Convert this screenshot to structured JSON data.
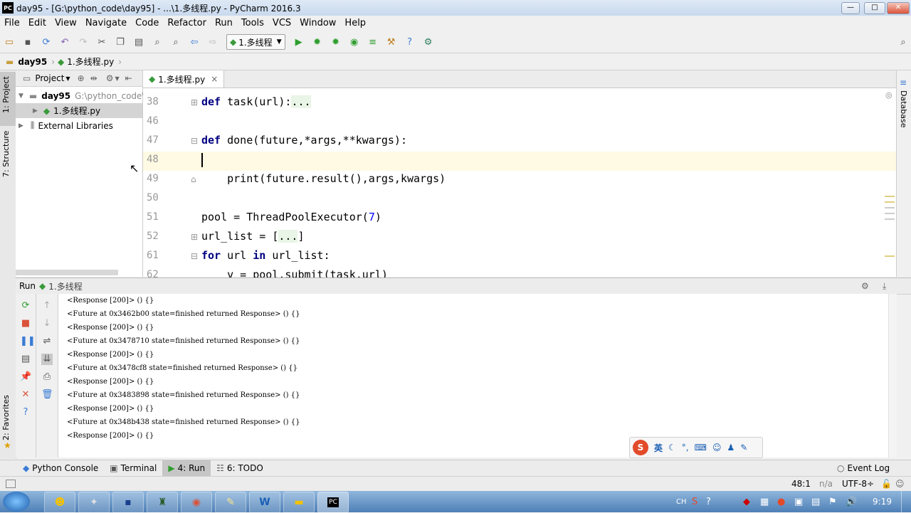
{
  "window": {
    "title": "day95 - [G:\\python_code\\day95] - ...\\1.多线程.py - PyCharm 2016.3",
    "logo": "PC",
    "minimize": "—",
    "maximize": "□",
    "close": "✕"
  },
  "menu": [
    "File",
    "Edit",
    "View",
    "Navigate",
    "Code",
    "Refactor",
    "Run",
    "Tools",
    "VCS",
    "Window",
    "Help"
  ],
  "toolbar": {
    "run_config": "1.多线程"
  },
  "navbar": {
    "crumbs": [
      "day95",
      "1.多线程.py"
    ]
  },
  "side_tabs": {
    "project": "1: Project",
    "structure": "7: Structure",
    "favorites": "2: Favorites",
    "database": "Database"
  },
  "project": {
    "header": "Project",
    "tree": [
      {
        "label": "day95",
        "path": "G:\\python_code\\"
      },
      {
        "label": "1.多线程.py"
      },
      {
        "label": "External Libraries"
      }
    ]
  },
  "editor": {
    "tab": "1.多线程.py",
    "tab_close": "×",
    "line_numbers": [
      "38",
      "46",
      "47",
      "48",
      "49",
      "50",
      "51",
      "52",
      "61",
      "62"
    ],
    "lines": [
      {
        "kw": "def",
        "rest": " task(url):",
        "fold": "..."
      },
      {
        "kw": "",
        "rest": ""
      },
      {
        "kw": "def",
        "rest": " done(future,*args,**kwargs):"
      },
      {
        "kw": "",
        "rest": ""
      },
      {
        "kw": "",
        "rest": "    print(future.result(),args,kwargs)"
      },
      {
        "kw": "",
        "rest": ""
      },
      {
        "kw": "",
        "rest": "pool = ThreadPoolExecutor(",
        "num": "7",
        "tail": ")"
      },
      {
        "kw": "",
        "rest": "url_list = [",
        "fold": "...",
        "tail": "]"
      },
      {
        "kw": "for",
        "rest": " url ",
        "kw2": "in",
        "tail": " url_list:"
      },
      {
        "kw": "",
        "rest": "    v = pool.submit(task,url)"
      }
    ]
  },
  "run": {
    "title": "Run",
    "config": "1.多线程",
    "output": [
      "<Response [200]> () {}",
      "<Future at 0x3462b00 state=finished returned Response> () {}",
      "<Response [200]> () {}",
      "<Future at 0x3478710 state=finished returned Response> () {}",
      "<Response [200]> () {}",
      "<Future at 0x3478cf8 state=finished returned Response> () {}",
      "<Response [200]> () {}",
      "<Future at 0x3483898 state=finished returned Response> () {}",
      "<Response [200]> () {}",
      "<Future at 0x348b438 state=finished returned Response> () {}",
      "<Response [200]> () {}"
    ]
  },
  "bottom_tabs": [
    "Python Console",
    "Terminal",
    "4: Run",
    "6: TODO"
  ],
  "event_log": "Event Log",
  "status": {
    "position": "48:1",
    "na": "n/a",
    "encoding": "UTF-8÷"
  },
  "ime": {
    "lang": "英"
  },
  "tray": {
    "lang": "CH",
    "time": "9:19"
  },
  "colors": {
    "keyword": "#000080",
    "number": "#0000ff",
    "caret_line": "#fffae3",
    "selected_tab_bg": "#ffffff"
  }
}
